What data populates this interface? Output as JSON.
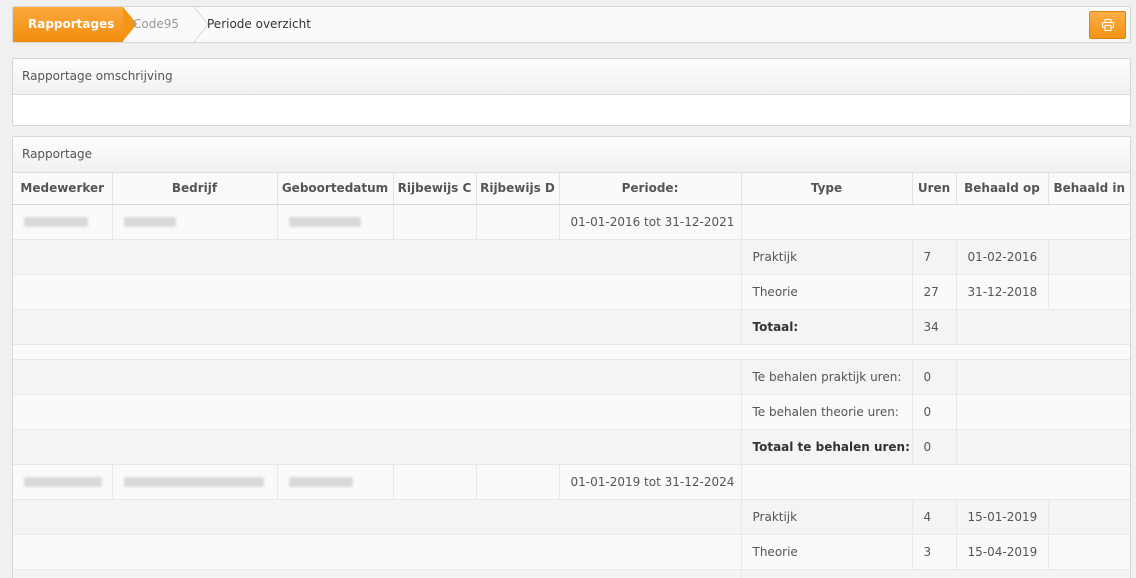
{
  "breadcrumb": {
    "items": [
      "Rapportages",
      "Code95",
      "Periode overzicht"
    ]
  },
  "toolbar": {
    "print_icon": "printer-icon"
  },
  "panel_description": {
    "title": "Rapportage omschrijving"
  },
  "panel_report": {
    "title": "Rapportage",
    "columns": [
      "Medewerker",
      "Bedrijf",
      "Geboortedatum",
      "Rijbewijs C",
      "Rijbewijs D",
      "Periode:",
      "Type",
      "Uren",
      "Behaald op",
      "Behaald in"
    ],
    "groups": [
      {
        "periode": "01-01-2016 tot 31-12-2021",
        "rows": [
          {
            "type": "Praktijk",
            "uren": "7",
            "behaald_op": "01-02-2016"
          },
          {
            "type": "Theorie",
            "uren": "27",
            "behaald_op": "31-12-2018"
          },
          {
            "type": "Totaal:",
            "uren": "34",
            "behaald_op": ""
          }
        ],
        "remaining": [
          {
            "type": "Te behalen praktijk uren:",
            "uren": "0"
          },
          {
            "type": "Te behalen theorie uren:",
            "uren": "0"
          },
          {
            "type": "Totaal te behalen uren:",
            "uren": "0"
          }
        ]
      },
      {
        "periode": "01-01-2019 tot 31-12-2024",
        "rows": [
          {
            "type": "Praktijk",
            "uren": "4",
            "behaald_op": "15-01-2019"
          },
          {
            "type": "Theorie",
            "uren": "3",
            "behaald_op": "15-04-2019"
          }
        ]
      }
    ]
  },
  "colors": {
    "accent": "#f49514",
    "accent_light": "#fcae45"
  }
}
